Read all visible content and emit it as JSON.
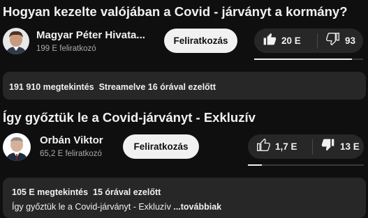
{
  "video1": {
    "title": "Hogyan kezelte valójában a Covid - járványt a kormány?",
    "channel_name": "Magyar Péter Hivata...",
    "subscribers": "199 E feliratkozó",
    "subscribe_label": "Feliratkozás",
    "likes": "20 E",
    "dislikes": "93",
    "like_ratio": 0.9,
    "views": "191 910 megtekintés",
    "streamed": "Streamelve 16 órával ezelőtt"
  },
  "video2": {
    "title": "Így győztük le a Covid-járványt - Exkluzív",
    "channel_name": "Orbán Viktor",
    "subscribers": "65,2 E feliratkozó",
    "subscribe_label": "Feliratkozás",
    "likes": "1,7 E",
    "dislikes": "13 E",
    "like_ratio": 0.12,
    "views": "105 E megtekintés",
    "posted": "15 órával ezelőtt",
    "description": "Így győztük le a Covid-járványt - Exkluzív ",
    "more_label": "...továbbiak"
  },
  "icons": {
    "like": "thumbs-up-icon",
    "dislike": "thumbs-down-icon"
  }
}
